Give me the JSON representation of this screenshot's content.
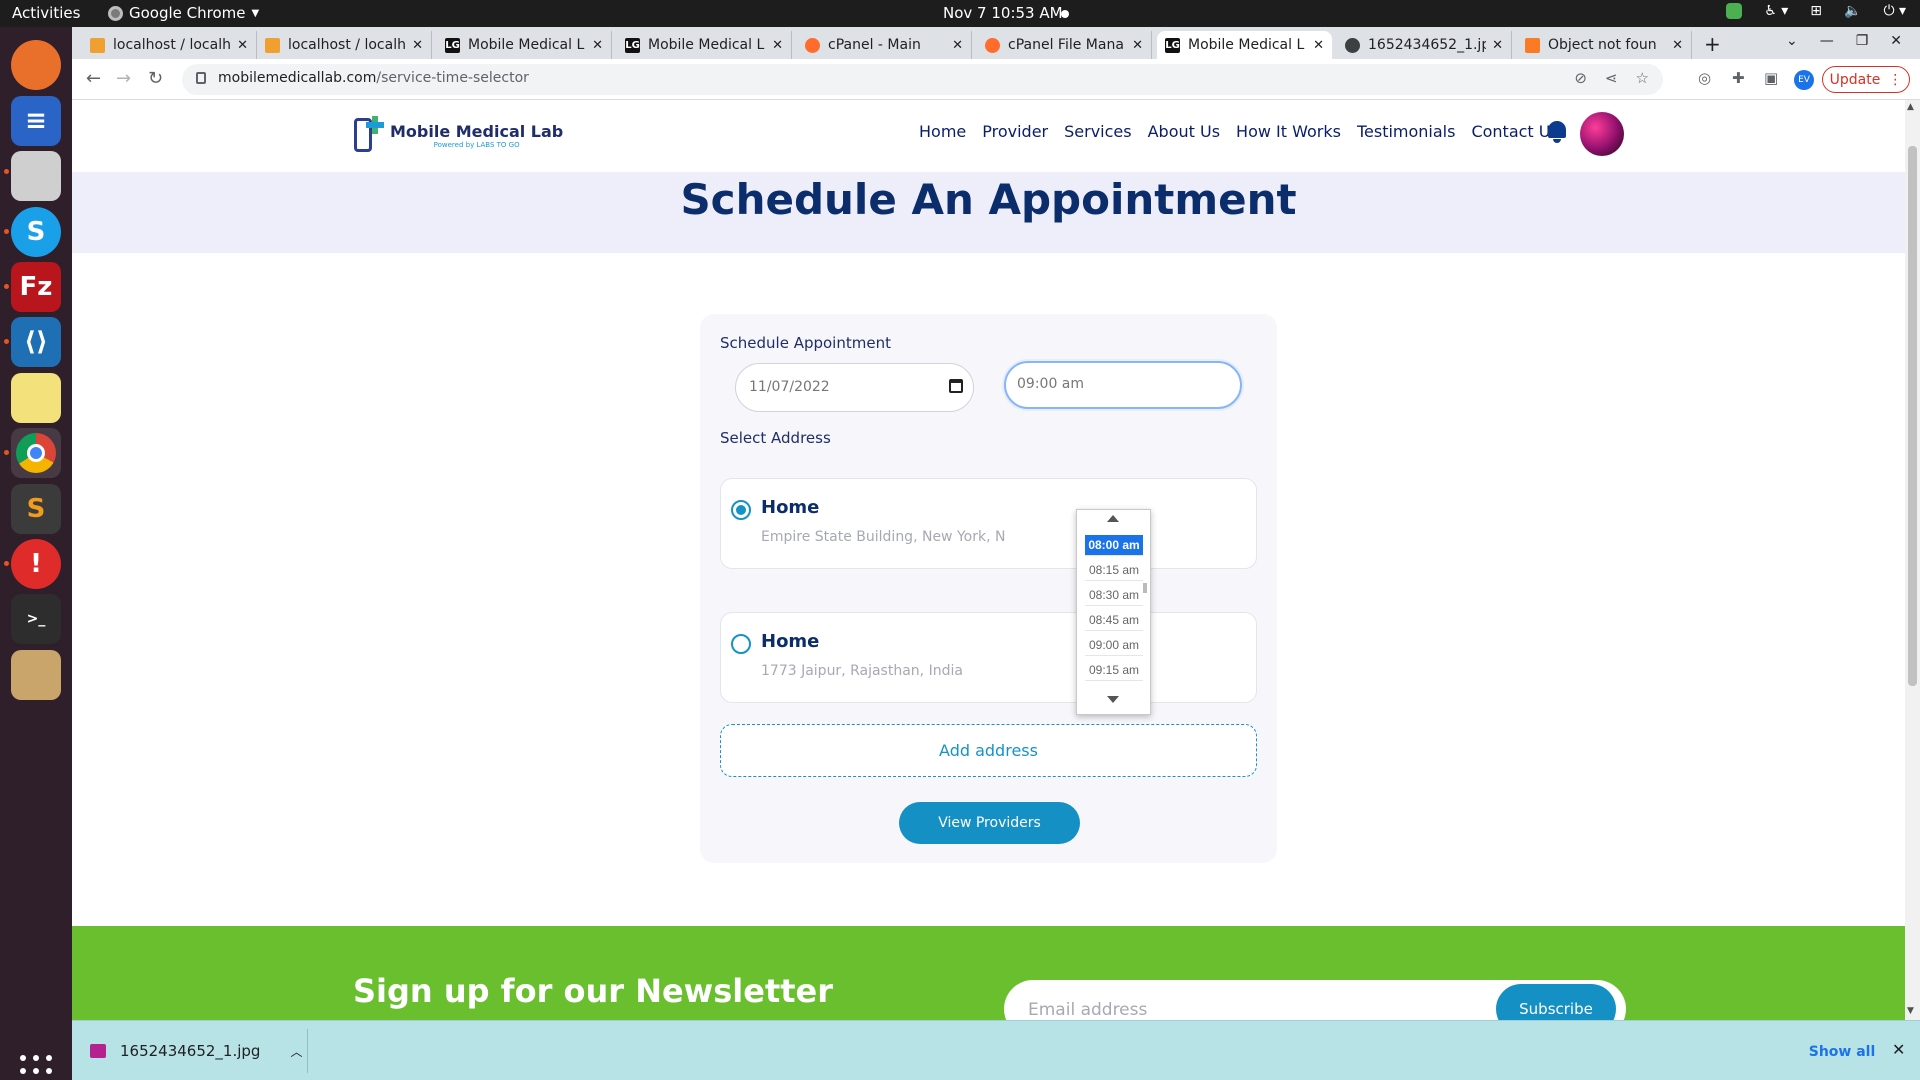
{
  "os": {
    "activities": "Activities",
    "app_name": "Google Chrome",
    "clock": "Nov 7  10:53 AM"
  },
  "browser": {
    "tabs": [
      {
        "title": "localhost / localh",
        "icon": "phpmyadmin-icon"
      },
      {
        "title": "localhost / localh",
        "icon": "phpmyadmin-icon"
      },
      {
        "title": "Mobile Medical L",
        "icon": "lg-favicon"
      },
      {
        "title": "Mobile Medical L",
        "icon": "lg-favicon"
      },
      {
        "title": "cPanel - Main",
        "icon": "cpanel-icon"
      },
      {
        "title": "cPanel File Mana",
        "icon": "cpanel-icon"
      },
      {
        "title": "Mobile Medical L",
        "icon": "lg-favicon",
        "active": true
      },
      {
        "title": "1652434652_1.jp",
        "icon": "globe-icon"
      },
      {
        "title": "Object not foun",
        "icon": "xampp-icon"
      }
    ],
    "url_host": "mobilemedicallab.com",
    "url_path": "/service-time-selector",
    "profile_initials": "EV",
    "update_label": "Update"
  },
  "site": {
    "logo_name": "Mobile Medical Lab",
    "logo_tagline": "Powered by LABS TO GO",
    "nav": [
      "Home",
      "Provider",
      "Services",
      "About Us",
      "How It Works",
      "Testimonials",
      "Contact Us"
    ],
    "page_title": "Schedule An Appointment"
  },
  "form": {
    "schedule_label": "Schedule Appointment",
    "date_value": "11/07/2022",
    "time_value": "09:00 am",
    "address_label": "Select Address",
    "addresses": [
      {
        "title": "Home",
        "line": "Empire State Building, New York, N",
        "selected": true
      },
      {
        "title": "Home",
        "line": "1773 Jaipur, Rajasthan, India",
        "selected": false
      }
    ],
    "add_address": "Add address",
    "view_providers": "View Providers"
  },
  "time_dropdown": {
    "options": [
      "08:00 am",
      "08:15 am",
      "08:30 am",
      "08:45 am",
      "09:00 am",
      "09:15 am"
    ],
    "highlighted": "08:00 am"
  },
  "newsletter": {
    "heading": "Sign up for our Newsletter",
    "email_placeholder": "Email address",
    "subscribe": "Subscribe"
  },
  "downloads": {
    "file": "1652434652_1.jpg",
    "show_all": "Show all"
  },
  "colors": {
    "brand_navy": "#0b2d6b",
    "brand_blue": "#1490c4",
    "newsletter_green": "#6abf2f",
    "selection_blue": "#1a73e8"
  }
}
